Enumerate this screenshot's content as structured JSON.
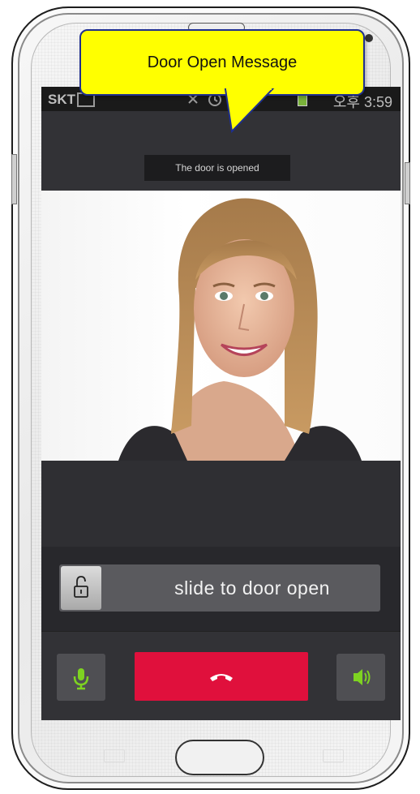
{
  "callout": {
    "text": "Door Open Message"
  },
  "statusbar": {
    "carrier": "SKT",
    "time": "오후 3:59"
  },
  "toast": {
    "message": "The door is opened"
  },
  "slider": {
    "label": "slide to door open"
  },
  "controls": {
    "mic_icon": "microphone-icon",
    "end_icon": "phone-hangup-icon",
    "speaker_icon": "speaker-icon",
    "lock_icon": "unlock-icon"
  },
  "colors": {
    "end_call": "#e0103c",
    "accent_green": "#7ed321",
    "callout_bg": "#ffff00",
    "callout_border": "#1f2f8f"
  }
}
